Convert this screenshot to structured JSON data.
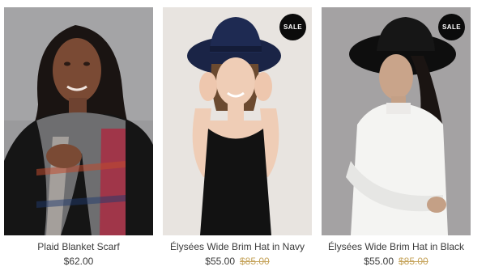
{
  "products": [
    {
      "name": "Plaid Blanket Scarf",
      "price": "$62.00",
      "image": "woman-in-plaid-blanket-scarf-photo"
    },
    {
      "name": "Élysées Wide Brim Hat in Navy",
      "price": "$55.00",
      "original_price": "$85.00",
      "badge": "SALE",
      "image": "woman-in-navy-wide-brim-hat-photo"
    },
    {
      "name": "Élysées Wide Brim Hat in Black",
      "price": "$55.00",
      "original_price": "$85.00",
      "badge": "SALE",
      "image": "woman-in-black-wide-brim-hat-photo"
    }
  ],
  "colors": {
    "sale_badge": "#0b0b0b",
    "original_price": "#c5a35a",
    "text": "#3a3a3a"
  }
}
